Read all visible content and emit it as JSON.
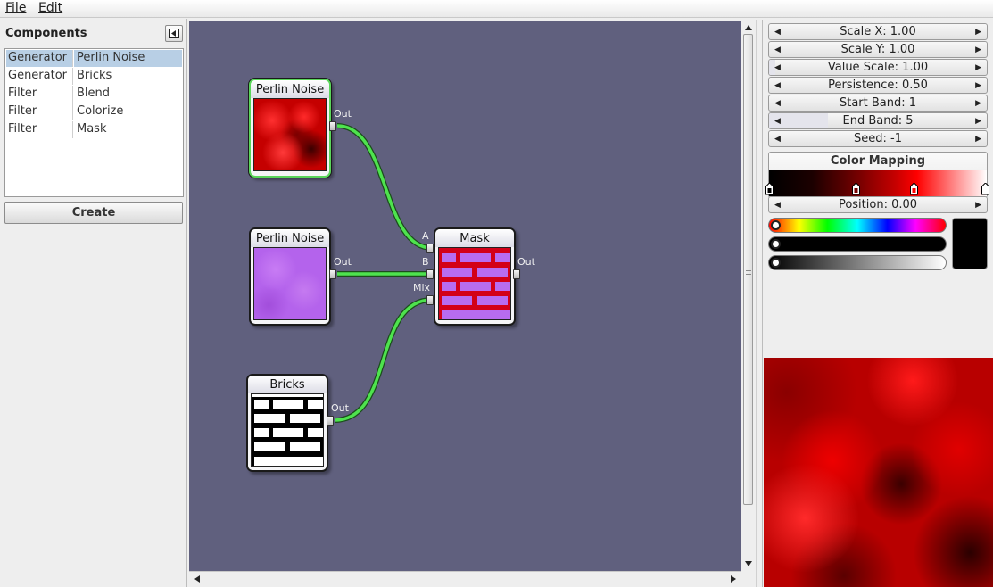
{
  "menu": {
    "file": "File",
    "edit": "Edit"
  },
  "components": {
    "title": "Components",
    "rows": [
      {
        "category": "Generator",
        "name": "Perlin Noise",
        "selected": true
      },
      {
        "category": "Generator",
        "name": "Bricks"
      },
      {
        "category": "Filter",
        "name": "Blend"
      },
      {
        "category": "Filter",
        "name": "Colorize"
      },
      {
        "category": "Filter",
        "name": "Mask"
      }
    ],
    "create_label": "Create"
  },
  "graph": {
    "nodes": {
      "perlin1": {
        "title": "Perlin Noise",
        "out": "Out"
      },
      "perlin2": {
        "title": "Perlin Noise",
        "out": "Out"
      },
      "bricks": {
        "title": "Bricks",
        "out": "Out"
      },
      "mask": {
        "title": "Mask",
        "in_a": "A",
        "in_b": "B",
        "in_mix": "Mix",
        "out": "Out"
      }
    },
    "connection_color": "#4ee34e",
    "background_color": "#60607e"
  },
  "properties": {
    "params": [
      {
        "label": "Scale X: 1.00"
      },
      {
        "label": "Scale Y: 1.00"
      },
      {
        "label": "Value Scale: 1.00",
        "level": 0.03
      },
      {
        "label": "Persistence: 0.50"
      },
      {
        "label": "Start Band: 1"
      },
      {
        "label": "End Band: 5",
        "level": 0.27
      },
      {
        "label": "Seed: -1"
      }
    ],
    "color_mapping": {
      "title": "Color Mapping",
      "position_label": "Position: 0.00",
      "stops": [
        "#000000",
        "#7a0000",
        "#ff0000",
        "#ffffff"
      ]
    },
    "selected_color": "#000000"
  }
}
